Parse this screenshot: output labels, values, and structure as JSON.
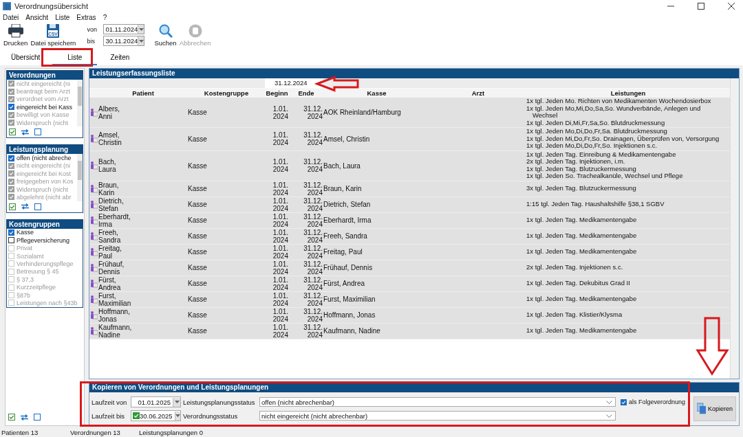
{
  "window": {
    "title": "Verordnungsübersicht"
  },
  "menu": [
    "Datei",
    "Ansicht",
    "Liste",
    "Extras",
    "?"
  ],
  "toolbar": {
    "files": [
      {
        "label": "Drucken",
        "kind": "print"
      },
      {
        "label": "Datei speichern",
        "kind": "csv",
        "icon_text": "CSV"
      }
    ],
    "range": [
      {
        "label": "von",
        "value": "01.11.2024"
      },
      {
        "label": "bis",
        "value": "30.11.2024"
      }
    ],
    "actions": [
      {
        "label": "Suchen",
        "kind": "search",
        "disabled": false
      },
      {
        "label": "Abbrechen",
        "kind": "cancel",
        "disabled": true
      }
    ]
  },
  "tabs": [
    {
      "label": "Übersicht",
      "selected": false
    },
    {
      "label": "Liste",
      "selected": true
    },
    {
      "label": "Zeiten",
      "selected": false
    }
  ],
  "filters": [
    {
      "title": "Verordnungen",
      "scrollable": true,
      "items": [
        {
          "label": "nicht eingereicht (ni",
          "checked": true,
          "disabled": true
        },
        {
          "label": "beantragt beim Arzt",
          "checked": true,
          "disabled": true
        },
        {
          "label": "verordnet vom Arzt",
          "checked": true,
          "disabled": true
        },
        {
          "label": "eingereicht bei Kass",
          "checked": true,
          "disabled": false
        },
        {
          "label": "bewilligt von Kasse",
          "checked": true,
          "disabled": true
        },
        {
          "label": "Widerspruch (nicht",
          "checked": true,
          "disabled": true
        }
      ]
    },
    {
      "title": "Leistungsplanung",
      "scrollable": true,
      "items": [
        {
          "label": "offen (nicht abreche",
          "checked": true,
          "disabled": false
        },
        {
          "label": "nicht eingereicht (ni",
          "checked": true,
          "disabled": true
        },
        {
          "label": "eingereicht bei Kost",
          "checked": true,
          "disabled": true
        },
        {
          "label": "freigegeben von Kos",
          "checked": true,
          "disabled": true
        },
        {
          "label": "Widerspruch (nicht",
          "checked": true,
          "disabled": true
        },
        {
          "label": "abgelehnt (nicht abr",
          "checked": true,
          "disabled": true
        }
      ]
    },
    {
      "title": "Kostengruppen",
      "scrollable": false,
      "items": [
        {
          "label": "Kasse",
          "checked": true,
          "disabled": false
        },
        {
          "label": "Pflegeversicherung",
          "checked": false,
          "disabled": false
        },
        {
          "label": "Privat",
          "checked": false,
          "disabled": true
        },
        {
          "label": "Sozialamt",
          "checked": false,
          "disabled": true
        },
        {
          "label": "Verhinderungspflege",
          "checked": false,
          "disabled": true
        },
        {
          "label": "Betreuung § 45",
          "checked": false,
          "disabled": true
        },
        {
          "label": "§ 37,3",
          "checked": false,
          "disabled": true
        },
        {
          "label": "Kurzzeitpflege",
          "checked": false,
          "disabled": true
        },
        {
          "label": "§87b",
          "checked": false,
          "disabled": true
        },
        {
          "label": "Leistungen nach §43b",
          "checked": false,
          "disabled": true
        }
      ]
    }
  ],
  "table": {
    "title": "Leistungserfassungsliste",
    "date_header": "31.12.2024",
    "columns": [
      "Patient",
      "Kostengruppe",
      "Beginn",
      "Ende",
      "Kasse",
      "Arzt",
      "Leistungen"
    ],
    "rows": [
      {
        "patient": "Albers, Anni",
        "kostengruppe": "Kasse",
        "beginn": "1.01. 2024",
        "ende": "31.12. 2024",
        "kasse": "AOK Rheinland/Hamburg",
        "leistungen": [
          "1x tgl. Jeden Mo. Richten von Medikamenten Wochendosierbox",
          "1x tgl. Jeden Mo,Mi,Do,Sa,So. Wundverbände, Anlegen und Wechsel",
          "1x tgl. Jeden Di,Mi,Fr,Sa,So. Blutdruckmessung"
        ]
      },
      {
        "patient": "Amsel, Christin",
        "kostengruppe": "Kasse",
        "beginn": "1.01. 2024",
        "ende": "31.12. 2024",
        "kasse": "Amsel, Christin",
        "leistungen": [
          "1x tgl. Jeden Mo,Di,Do,Fr,Sa. Blutdruckmessung",
          "1x tgl. Jeden Mi,Do,Fr,So. Drainagen, Überprüfen von, Versorgung",
          "1x tgl. Jeden Mo,Di,Do,Fr,So. Injektionen s.c."
        ]
      },
      {
        "patient": "Bach, Laura",
        "kostengruppe": "Kasse",
        "beginn": "1.01. 2024",
        "ende": "31.12. 2024",
        "kasse": "Bach, Laura",
        "leistungen": [
          "1x tgl. Jeden Tag. Einreibung & Medikamentengabe",
          "2x tgl. Jeden Tag. Injektionen, i.m.",
          "1x tgl. Jeden Tag. Blutzuckermessung",
          "1x tgl. Jeden So. Trachealkanüle, Wechsel und Pflege"
        ]
      },
      {
        "patient": "Braun, Karin",
        "kostengruppe": "Kasse",
        "beginn": "1.01. 2024",
        "ende": "31.12. 2024",
        "kasse": "Braun, Karin",
        "leistungen": [
          "3x tgl. Jeden Tag. Blutzuckermessung"
        ]
      },
      {
        "patient": "Dietrich, Stefan",
        "kostengruppe": "Kasse",
        "beginn": "1.01. 2024",
        "ende": "31.12. 2024",
        "kasse": "Dietrich, Stefan",
        "leistungen": [
          "1:15 tgl. Jeden Tag. Haushaltshilfe §38,1 SGBV"
        ]
      },
      {
        "patient": "Eberhardt, Irma",
        "kostengruppe": "Kasse",
        "beginn": "1.01. 2024",
        "ende": "31.12. 2024",
        "kasse": "Eberhardt, Irma",
        "leistungen": [
          "1x tgl. Jeden Tag. Medikamentengabe"
        ]
      },
      {
        "patient": "Freeh, Sandra",
        "kostengruppe": "Kasse",
        "beginn": "1.01. 2024",
        "ende": "31.12. 2024",
        "kasse": "Freeh, Sandra",
        "leistungen": [
          "1x tgl. Jeden Tag. Medikamentengabe"
        ]
      },
      {
        "patient": "Freitag, Paul",
        "kostengruppe": "Kasse",
        "beginn": "1.01. 2024",
        "ende": "31.12. 2024",
        "kasse": "Freitag, Paul",
        "leistungen": [
          "1x tgl. Jeden Tag. Medikamentengabe"
        ]
      },
      {
        "patient": "Frühauf, Dennis",
        "kostengruppe": "Kasse",
        "beginn": "1.01. 2024",
        "ende": "31.12. 2024",
        "kasse": "Frühauf, Dennis",
        "leistungen": [
          "2x tgl. Jeden Tag. Injektionen s.c."
        ]
      },
      {
        "patient": "Fürst, Andrea",
        "kostengruppe": "Kasse",
        "beginn": "1.01. 2024",
        "ende": "31.12. 2024",
        "kasse": "Fürst, Andrea",
        "leistungen": [
          "1x tgl. Jeden Tag. Dekubitus Grad II"
        ]
      },
      {
        "patient": "Furst, Maximilian",
        "kostengruppe": "Kasse",
        "beginn": "1.01. 2024",
        "ende": "31.12. 2024",
        "kasse": "Furst, Maximilian",
        "leistungen": [
          "1x tgl. Jeden Tag. Medikamentengabe"
        ]
      },
      {
        "patient": "Hoffmann, Jonas",
        "kostengruppe": "Kasse",
        "beginn": "1.01. 2024",
        "ende": "31.12. 2024",
        "kasse": "Hoffmann, Jonas",
        "leistungen": [
          "1x tgl. Jeden Tag. Klistier/Klysma"
        ]
      },
      {
        "patient": "Kaufmann, Nadine",
        "kostengruppe": "Kasse",
        "beginn": "1.01. 2024",
        "ende": "31.12. 2024",
        "kasse": "Kaufmann, Nadine",
        "leistungen": [
          "1x tgl. Jeden Tag. Medikamentengabe"
        ]
      }
    ]
  },
  "copy_panel": {
    "title": "Kopieren von Verordnungen und Leistungsplanungen",
    "rows": [
      {
        "label": "Laufzeit von",
        "date": "01.01.2025",
        "has_checkbox": false,
        "status_label": "Leistungsplanungsstatus",
        "status_value": "offen (nicht abrechenbar)"
      },
      {
        "label": "Laufzeit bis",
        "date": "30.06.2025",
        "has_checkbox": true,
        "checked": true,
        "status_label": "Verordnungsstatus",
        "status_value": "nicht eingereicht (nicht abrechenbar)"
      }
    ],
    "follow_up": {
      "label": "als Folgeverordnung",
      "checked": true
    },
    "button": "Kopieren"
  },
  "status_bar": [
    "Patienten 13",
    "Verordnungen 13",
    "Leistungsplanungen 0"
  ]
}
